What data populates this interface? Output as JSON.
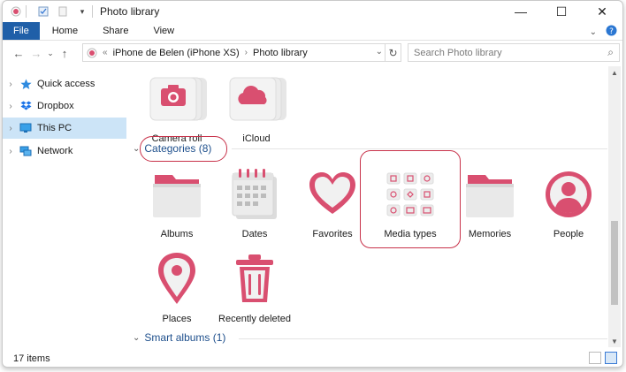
{
  "window": {
    "title": "Photo library"
  },
  "ribbon": {
    "tabs": [
      "File",
      "Home",
      "Share",
      "View"
    ]
  },
  "address": {
    "overflow": "«",
    "crumbs": [
      "iPhone de Belen (iPhone XS)",
      "Photo library"
    ]
  },
  "search": {
    "placeholder": "Search Photo library"
  },
  "sidebar": {
    "items": [
      {
        "label": "Quick access",
        "icon": "star-icon"
      },
      {
        "label": "Dropbox",
        "icon": "dropbox-icon"
      },
      {
        "label": "This PC",
        "icon": "pc-icon",
        "selected": true
      },
      {
        "label": "Network",
        "icon": "network-icon"
      }
    ]
  },
  "content": {
    "top_items": [
      {
        "label": "Camera roll",
        "icon": "camera-icon"
      },
      {
        "label": "iCloud",
        "icon": "cloud-icon"
      }
    ],
    "categories_header": "Categories (8)",
    "categories": [
      {
        "label": "Albums",
        "icon": "folder-icon"
      },
      {
        "label": "Dates",
        "icon": "calendar-icon"
      },
      {
        "label": "Favorites",
        "icon": "heart-icon"
      },
      {
        "label": "Media types",
        "icon": "media-types-icon"
      },
      {
        "label": "Memories",
        "icon": "folder-icon"
      },
      {
        "label": "People",
        "icon": "person-icon"
      },
      {
        "label": "Places",
        "icon": "map-pin-icon"
      },
      {
        "label": "Recently deleted",
        "icon": "trash-icon"
      }
    ],
    "smart_albums_header": "Smart albums (1)"
  },
  "status": {
    "item_count": "17 items"
  },
  "colors": {
    "accent": "#d94f70",
    "accent_light": "#f2c4cf",
    "highlight_ring": "#c8324a",
    "selection": "#cce4f7",
    "file_tab": "#1f5fa8"
  }
}
